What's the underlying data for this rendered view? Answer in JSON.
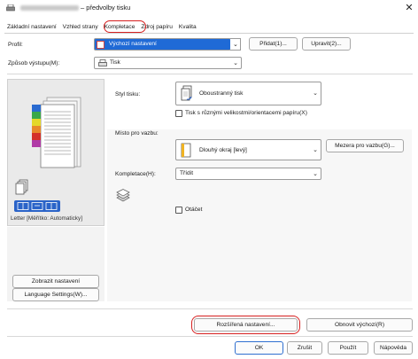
{
  "window": {
    "title": "– předvolby tisku",
    "close_glyph": "✕"
  },
  "tabs": [
    {
      "label": "Základní nastavení"
    },
    {
      "label": "Vzhled strany"
    },
    {
      "label": "Kompletace"
    },
    {
      "label": "Zdroj papíru"
    },
    {
      "label": "Kvalita"
    }
  ],
  "profile": {
    "label": "Profil:",
    "value": "Výchozí nastavení",
    "add_button": "Přidat(1)...",
    "edit_button": "Upravit(2)..."
  },
  "output": {
    "label": "Způsob výstupu(M):",
    "value": "Tisk"
  },
  "preview": {
    "caption": "Letter [Měřítko: Automaticky]",
    "show_settings_button": "Zobrazit nastavení",
    "language_button": "Language Settings(W)..."
  },
  "print_style": {
    "label": "Styl tisku:",
    "value": "Oboustranný tisk",
    "mixed_sizes_checkbox": "Tisk s různými velikostmi/orientacemi papíru(X)",
    "mixed_sizes_checked": false
  },
  "binding": {
    "label": "Místo pro vazbu:",
    "value": "Dlouhý okraj [levý]",
    "margin_button": "Mezera pro vazbu(G)..."
  },
  "finishing": {
    "label": "Kompletace(H):",
    "value": "Třídit",
    "rotate_checkbox": "Otáčet",
    "rotate_checked": false
  },
  "footer": {
    "advanced_button": "Rozšířená nastavení...",
    "restore_button": "Obnovit výchozí(R)",
    "ok_button": "OK",
    "cancel_button": "Zrušit",
    "apply_button": "Použít",
    "help_button": "Nápověda"
  },
  "colors": {
    "accent_blue": "#1f6ad6",
    "highlight_red": "#d62020"
  }
}
